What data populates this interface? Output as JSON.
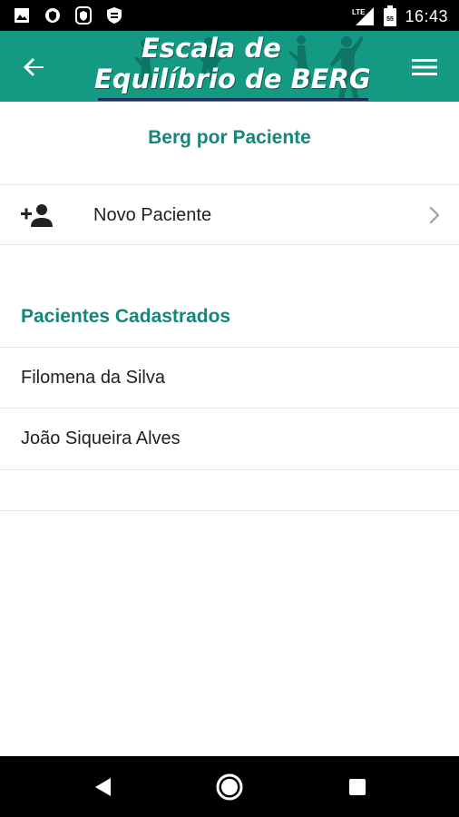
{
  "status_bar": {
    "time": "16:43",
    "network": "LTE",
    "battery": "55",
    "left_icons": [
      "image-icon",
      "shield-icon",
      "square-shield-icon",
      "badge-icon"
    ]
  },
  "app_bar": {
    "logo_line1": "Escala de",
    "logo_line2": "Equilíbrio de BERG",
    "back_icon": "arrow-back-icon",
    "menu_icon": "hamburger-menu-icon",
    "color": "#149a83"
  },
  "main": {
    "title": "Berg por Paciente",
    "new_patient_label": "Novo Paciente",
    "registered_header": "Pacientes Cadastrados",
    "patients": [
      {
        "name": "Filomena da Silva"
      },
      {
        "name": "João Siqueira Alves"
      }
    ],
    "accent_color": "#17867a"
  },
  "nav_bar": {
    "buttons": [
      "back-triangle-icon",
      "home-circle-icon",
      "recents-square-icon"
    ]
  }
}
